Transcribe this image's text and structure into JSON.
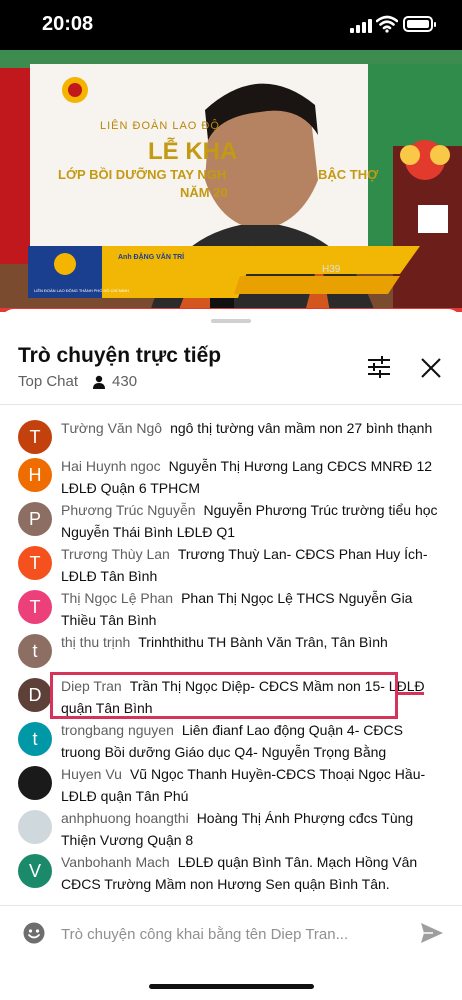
{
  "status_bar": {
    "time": "20:08"
  },
  "video": {
    "banner_org": "LIÊN ĐOÀN LAO ĐỘ",
    "banner_title": "LỄ KHA",
    "banner_subtitle": "LỚP BỒI DƯỠNG TAY NGH",
    "banner_subtitle2": "BẬC THỢ",
    "banner_year": "NĂM 20",
    "lower_third_name": "Anh ĐẶNG VĂN TRÍ",
    "lower_third_org": "LIÊN ĐOÀN LAO ĐỘNG THÀNH PHỐ HỒ CHÍ MINH",
    "tag": "H39"
  },
  "chat": {
    "title": "Trò chuyện trực tiếp",
    "mode": "Top Chat",
    "viewer_count": "430",
    "input_placeholder": "Trò chuyện công khai bằng tên Diep Tran...",
    "messages": [
      {
        "initial": "T",
        "color": "#c2410c",
        "author": "Tường Văn Ngô",
        "text": "ngô thị tường vân mầm non 27 bình thạnh"
      },
      {
        "initial": "H",
        "color": "#ef6c00",
        "author": "Hai Huynh ngoc",
        "text": "Nguyễn Thị Hương Lang CĐCS MNRĐ 12 LĐLĐ Quận 6 TPHCM"
      },
      {
        "initial": "P",
        "color": "#8d6e63",
        "author": "Phương Trúc Nguyễn",
        "text": "Nguyễn Phương Trúc trường tiểu học Nguyễn Thái Bình LĐLĐ Q1"
      },
      {
        "initial": "T",
        "color": "#f4511e",
        "author": "Trương Thùy Lan",
        "text": "Trương Thuỳ Lan- CĐCS Phan Huy Ích- LĐLĐ Tân Bình"
      },
      {
        "initial": "T",
        "color": "#ec407a",
        "author": "Thị Ngọc Lệ Phan",
        "text": "Phan Thị Ngọc Lệ THCS Nguyễn Gia Thiều Tân Bình"
      },
      {
        "initial": "t",
        "color": "#8d6e63",
        "author": "thị thu trịnh",
        "text": "Trinhthithu TH Bành Văn Trân, Tân Bình"
      },
      {
        "initial": "D",
        "color": "#5d4037",
        "author": "Diep Tran",
        "text": "Trần Thị Ngọc Diệp- CĐCS Mầm non 15- LĐLĐ quận Tân Bình"
      },
      {
        "initial": "t",
        "color": "#0097a7",
        "author": "trongbang nguyen",
        "text": "Liên đianf Lao động Quận 4- CĐCS truong Bồi dưỡng Giáo dục Q4- Nguyễn Trọng Bằng"
      },
      {
        "initial": "",
        "color": "#1a1a1a",
        "author": "Huyen Vu",
        "text": "Vũ Ngọc Thanh Huyền-CĐCS Thoại Ngọc Hầu- LĐLĐ quận Tân Phú"
      },
      {
        "initial": "",
        "color": "#cfd8dc",
        "author": "anhphuong hoangthi",
        "text": "Hoàng Thị Ánh Phượng cđcs Tùng Thiện Vương Quận 8"
      },
      {
        "initial": "V",
        "color": "#1b8a6b",
        "author": "Vanbohanh Mach",
        "text": "LĐLĐ quận Bình Tân. Mạch Hồng Vân CĐCS Trường Mầm non Hương Sen quận Bình Tân."
      }
    ]
  }
}
